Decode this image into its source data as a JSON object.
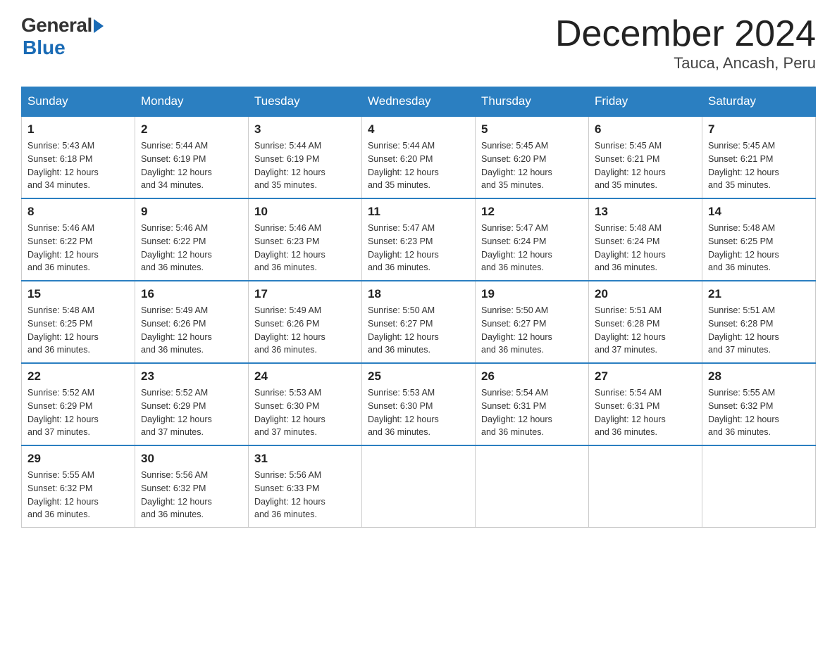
{
  "logo": {
    "general": "General",
    "blue": "Blue",
    "subtitle": ""
  },
  "calendar": {
    "title": "December 2024",
    "subtitle": "Tauca, Ancash, Peru"
  },
  "weekdays": [
    "Sunday",
    "Monday",
    "Tuesday",
    "Wednesday",
    "Thursday",
    "Friday",
    "Saturday"
  ],
  "weeks": [
    [
      {
        "day": "1",
        "sunrise": "5:43 AM",
        "sunset": "6:18 PM",
        "daylight": "12 hours and 34 minutes."
      },
      {
        "day": "2",
        "sunrise": "5:44 AM",
        "sunset": "6:19 PM",
        "daylight": "12 hours and 34 minutes."
      },
      {
        "day": "3",
        "sunrise": "5:44 AM",
        "sunset": "6:19 PM",
        "daylight": "12 hours and 35 minutes."
      },
      {
        "day": "4",
        "sunrise": "5:44 AM",
        "sunset": "6:20 PM",
        "daylight": "12 hours and 35 minutes."
      },
      {
        "day": "5",
        "sunrise": "5:45 AM",
        "sunset": "6:20 PM",
        "daylight": "12 hours and 35 minutes."
      },
      {
        "day": "6",
        "sunrise": "5:45 AM",
        "sunset": "6:21 PM",
        "daylight": "12 hours and 35 minutes."
      },
      {
        "day": "7",
        "sunrise": "5:45 AM",
        "sunset": "6:21 PM",
        "daylight": "12 hours and 35 minutes."
      }
    ],
    [
      {
        "day": "8",
        "sunrise": "5:46 AM",
        "sunset": "6:22 PM",
        "daylight": "12 hours and 36 minutes."
      },
      {
        "day": "9",
        "sunrise": "5:46 AM",
        "sunset": "6:22 PM",
        "daylight": "12 hours and 36 minutes."
      },
      {
        "day": "10",
        "sunrise": "5:46 AM",
        "sunset": "6:23 PM",
        "daylight": "12 hours and 36 minutes."
      },
      {
        "day": "11",
        "sunrise": "5:47 AM",
        "sunset": "6:23 PM",
        "daylight": "12 hours and 36 minutes."
      },
      {
        "day": "12",
        "sunrise": "5:47 AM",
        "sunset": "6:24 PM",
        "daylight": "12 hours and 36 minutes."
      },
      {
        "day": "13",
        "sunrise": "5:48 AM",
        "sunset": "6:24 PM",
        "daylight": "12 hours and 36 minutes."
      },
      {
        "day": "14",
        "sunrise": "5:48 AM",
        "sunset": "6:25 PM",
        "daylight": "12 hours and 36 minutes."
      }
    ],
    [
      {
        "day": "15",
        "sunrise": "5:48 AM",
        "sunset": "6:25 PM",
        "daylight": "12 hours and 36 minutes."
      },
      {
        "day": "16",
        "sunrise": "5:49 AM",
        "sunset": "6:26 PM",
        "daylight": "12 hours and 36 minutes."
      },
      {
        "day": "17",
        "sunrise": "5:49 AM",
        "sunset": "6:26 PM",
        "daylight": "12 hours and 36 minutes."
      },
      {
        "day": "18",
        "sunrise": "5:50 AM",
        "sunset": "6:27 PM",
        "daylight": "12 hours and 36 minutes."
      },
      {
        "day": "19",
        "sunrise": "5:50 AM",
        "sunset": "6:27 PM",
        "daylight": "12 hours and 36 minutes."
      },
      {
        "day": "20",
        "sunrise": "5:51 AM",
        "sunset": "6:28 PM",
        "daylight": "12 hours and 37 minutes."
      },
      {
        "day": "21",
        "sunrise": "5:51 AM",
        "sunset": "6:28 PM",
        "daylight": "12 hours and 37 minutes."
      }
    ],
    [
      {
        "day": "22",
        "sunrise": "5:52 AM",
        "sunset": "6:29 PM",
        "daylight": "12 hours and 37 minutes."
      },
      {
        "day": "23",
        "sunrise": "5:52 AM",
        "sunset": "6:29 PM",
        "daylight": "12 hours and 37 minutes."
      },
      {
        "day": "24",
        "sunrise": "5:53 AM",
        "sunset": "6:30 PM",
        "daylight": "12 hours and 37 minutes."
      },
      {
        "day": "25",
        "sunrise": "5:53 AM",
        "sunset": "6:30 PM",
        "daylight": "12 hours and 36 minutes."
      },
      {
        "day": "26",
        "sunrise": "5:54 AM",
        "sunset": "6:31 PM",
        "daylight": "12 hours and 36 minutes."
      },
      {
        "day": "27",
        "sunrise": "5:54 AM",
        "sunset": "6:31 PM",
        "daylight": "12 hours and 36 minutes."
      },
      {
        "day": "28",
        "sunrise": "5:55 AM",
        "sunset": "6:32 PM",
        "daylight": "12 hours and 36 minutes."
      }
    ],
    [
      {
        "day": "29",
        "sunrise": "5:55 AM",
        "sunset": "6:32 PM",
        "daylight": "12 hours and 36 minutes."
      },
      {
        "day": "30",
        "sunrise": "5:56 AM",
        "sunset": "6:32 PM",
        "daylight": "12 hours and 36 minutes."
      },
      {
        "day": "31",
        "sunrise": "5:56 AM",
        "sunset": "6:33 PM",
        "daylight": "12 hours and 36 minutes."
      },
      null,
      null,
      null,
      null
    ]
  ]
}
